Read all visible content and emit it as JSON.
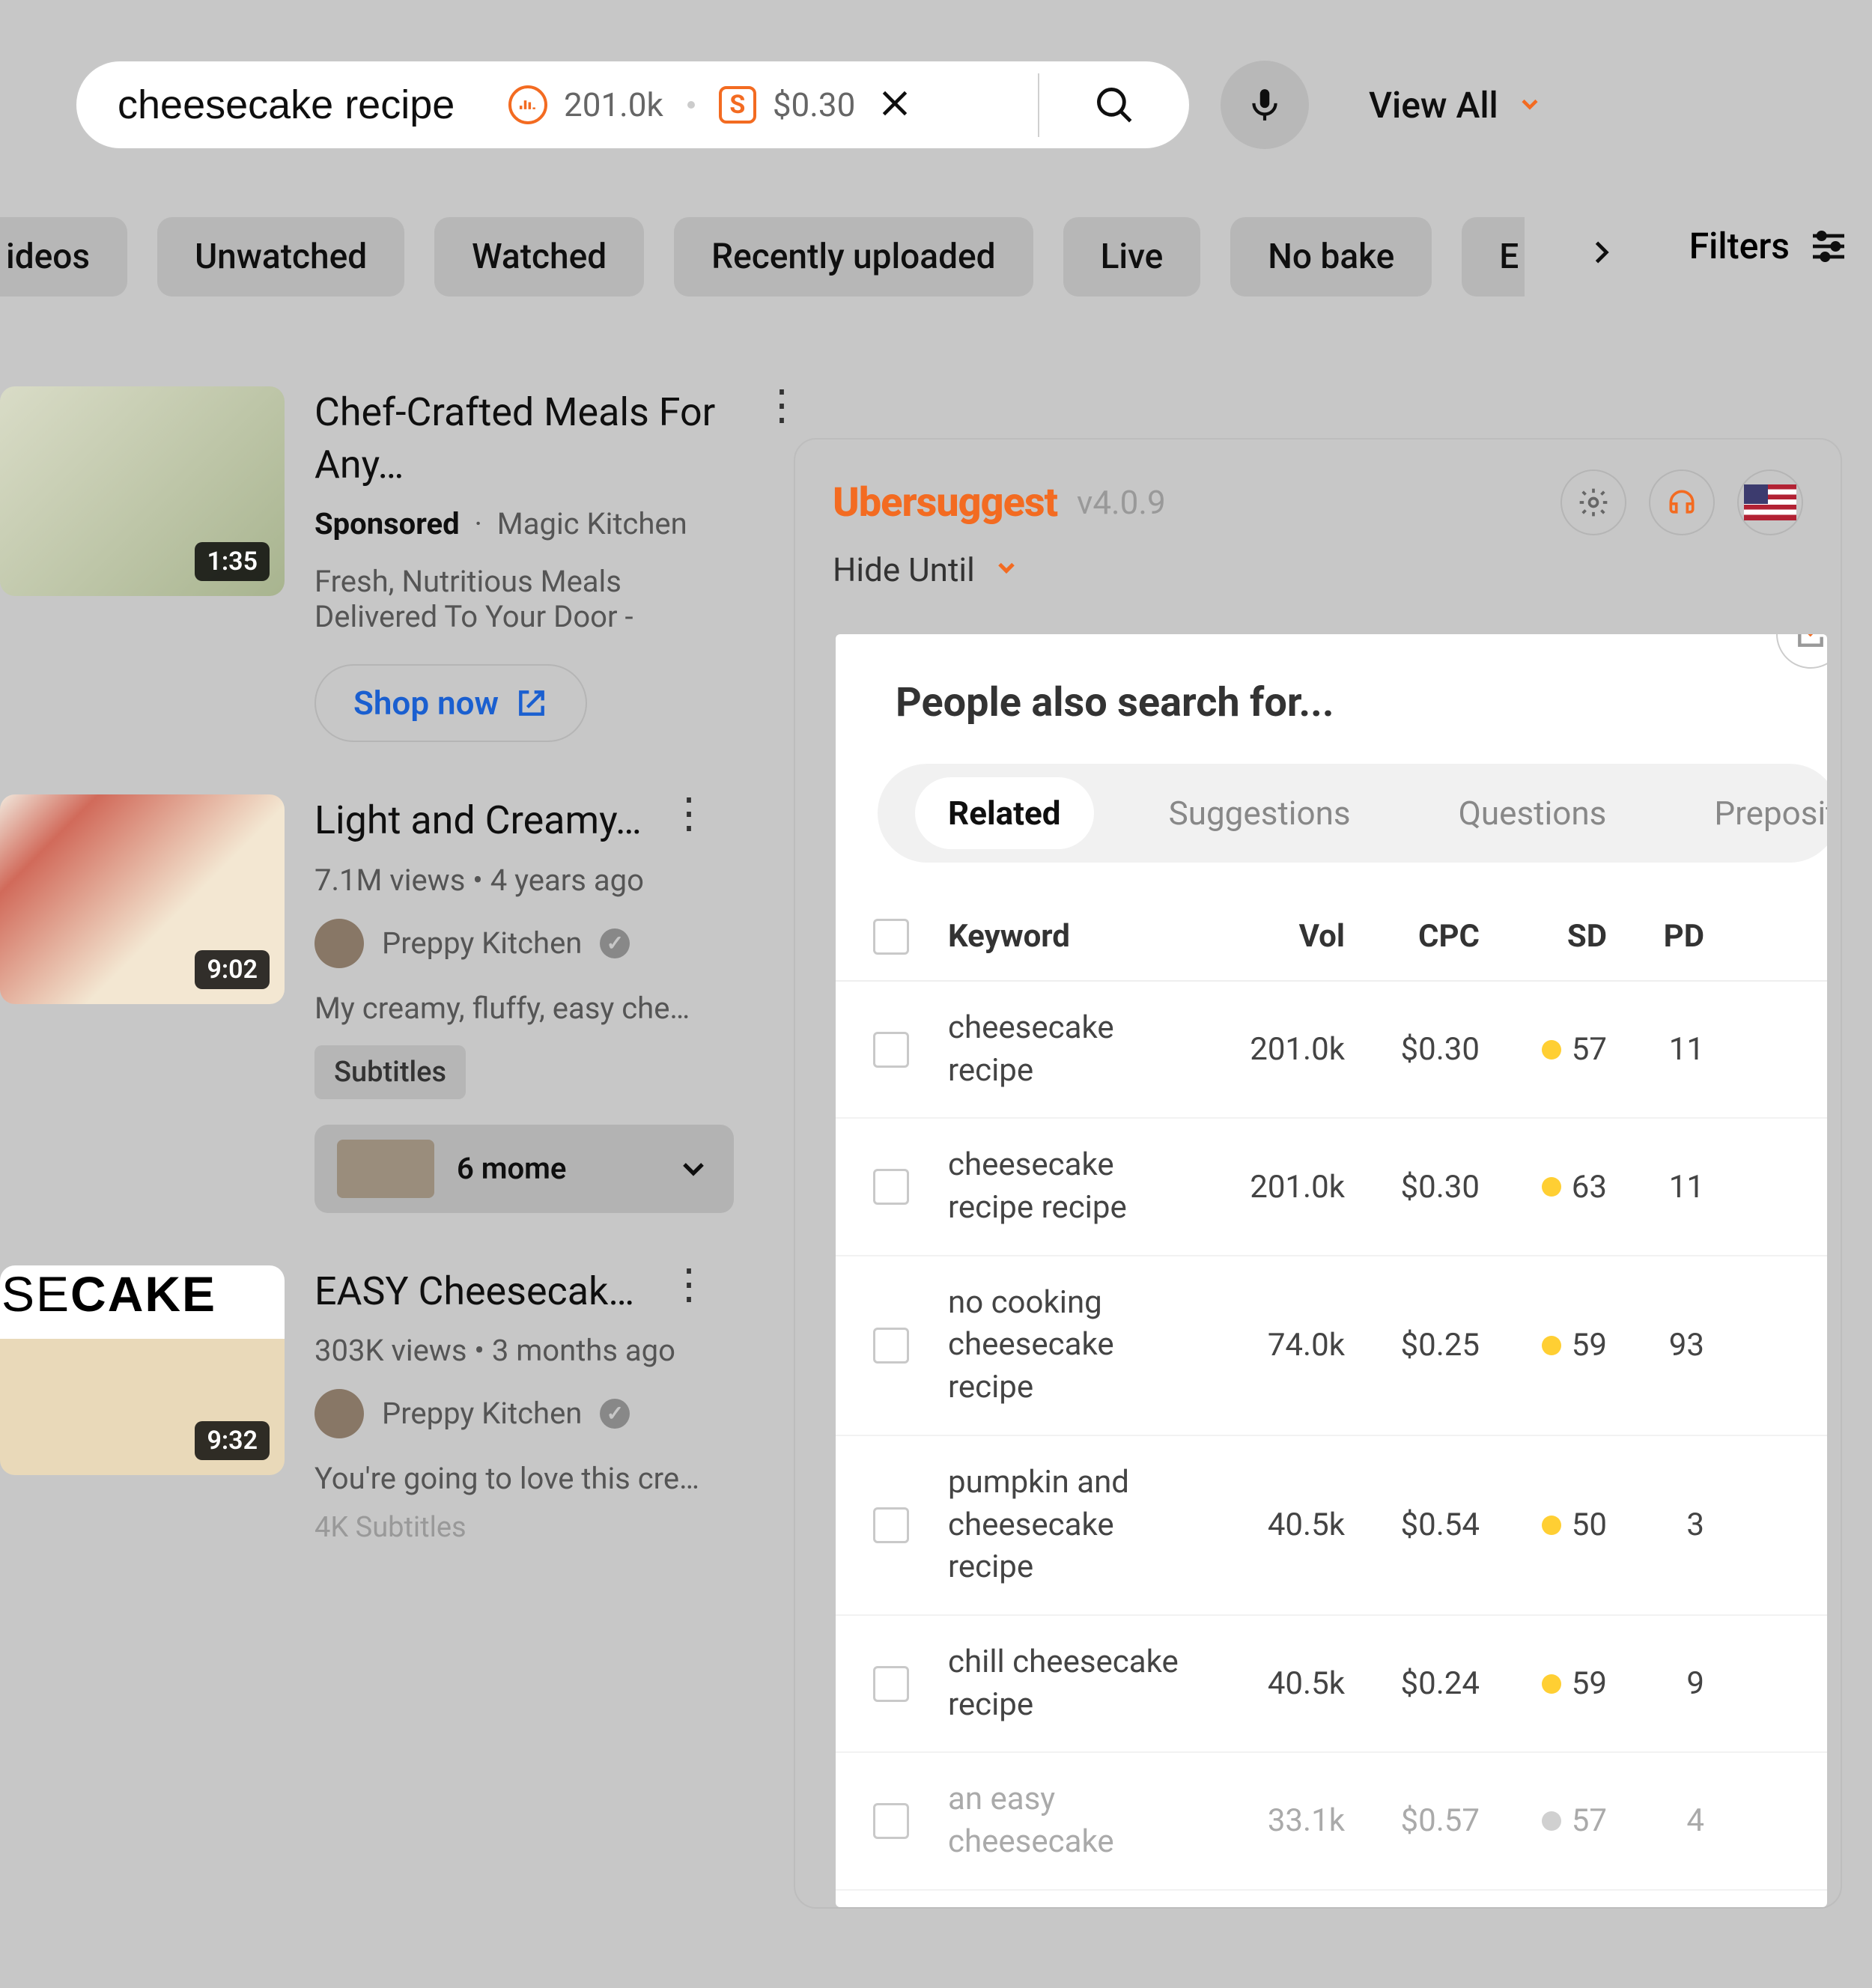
{
  "search": {
    "query": "cheesecake recipe",
    "volume": "201.0k",
    "cpc": "$0.30",
    "mic_aria": "voice search",
    "view_all": "View All"
  },
  "chips": {
    "c0": "ideos",
    "c1": "Unwatched",
    "c2": "Watched",
    "c3": "Recently uploaded",
    "c4": "Live",
    "c5": "No bake",
    "c6": "E",
    "filters": "Filters"
  },
  "results": {
    "r1": {
      "title": "Chef-Crafted Meals For Any…",
      "sponsored": "Sponsored",
      "advertiser": "Magic Kitchen",
      "desc": "Fresh, Nutritious Meals Delivered To Your Door -",
      "duration": "1:35",
      "cta": "Shop now"
    },
    "r2": {
      "title": "Light and Creamy…",
      "sub": "7.1M views  •  4 years ago",
      "channel": "Preppy Kitchen",
      "desc": "My creamy, fluffy, easy che…",
      "duration": "9:02",
      "tag": "Subtitles",
      "moments": "6 mome"
    },
    "r3": {
      "title": "EASY Cheesecak…",
      "sub": "303K views  •  3 months ago",
      "channel": "Preppy Kitchen",
      "desc": "You're going to love this cre…",
      "duration": "9:32",
      "cakeText": "SECAKE",
      "tags": "4K   Subtitles"
    }
  },
  "us": {
    "logo": "Ubersuggest",
    "version": "v4.0.9",
    "hide": "Hide Until",
    "panel_title": "People also search for...",
    "tabs": {
      "t1": "Related",
      "t2": "Suggestions",
      "t3": "Questions",
      "t4": "Prepositio"
    },
    "th": {
      "kw": "Keyword",
      "vol": "Vol",
      "cpc": "CPC",
      "sd": "SD",
      "pd": "PD"
    },
    "rows": {
      "r1": {
        "kw": "cheesecake recipe",
        "vol": "201.0k",
        "cpc": "$0.30",
        "sd": "57",
        "pd": "11"
      },
      "r2": {
        "kw": "cheesecake recipe recipe",
        "vol": "201.0k",
        "cpc": "$0.30",
        "sd": "63",
        "pd": "11"
      },
      "r3": {
        "kw": "no cooking cheesecake recipe",
        "vol": "74.0k",
        "cpc": "$0.25",
        "sd": "59",
        "pd": "93"
      },
      "r4": {
        "kw": "pumpkin and cheesecake recipe",
        "vol": "40.5k",
        "cpc": "$0.54",
        "sd": "50",
        "pd": "3"
      },
      "r5": {
        "kw": "chill cheesecake recipe",
        "vol": "40.5k",
        "cpc": "$0.24",
        "sd": "59",
        "pd": "9"
      },
      "r6": {
        "kw": "an easy cheesecake",
        "vol": "33.1k",
        "cpc": "$0.57",
        "sd": "57",
        "pd": "4"
      }
    }
  }
}
